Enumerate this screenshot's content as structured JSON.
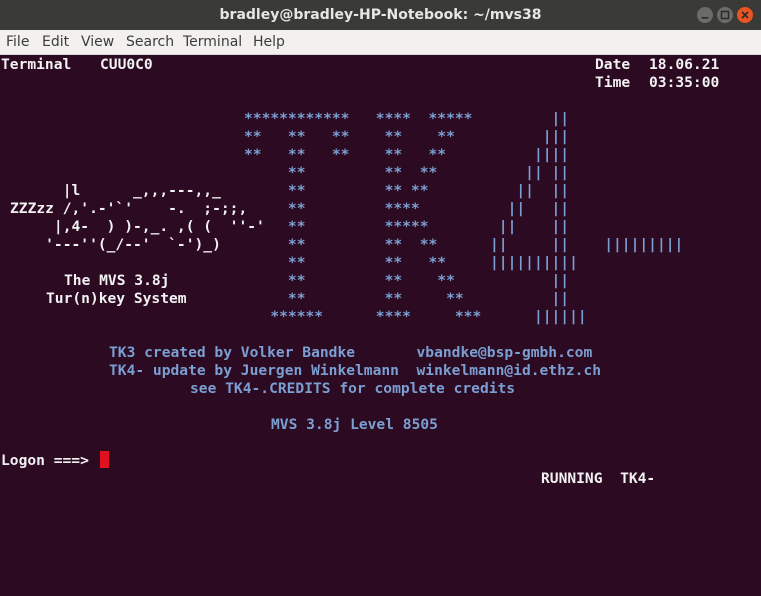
{
  "window": {
    "title": "bradley@bradley-HP-Notebook: ~/mvs38",
    "buttons": [
      "minimize-icon",
      "maximize-icon",
      "close-icon"
    ]
  },
  "menu": [
    "File",
    "Edit",
    "View",
    "Search",
    "Terminal",
    "Help"
  ],
  "colors": {
    "terminal_bg": "#2c0a22",
    "text_white": "#f2f2f2",
    "text_blue": "#7b9fd2",
    "cursor": "#e2111f",
    "close_button": "#e95420"
  },
  "terminal": {
    "terminal_label": "Terminal",
    "terminal_id": "CUU0C0",
    "date_label": "Date",
    "date_value": "18.06.21",
    "time_label": "Time",
    "time_value": "03:35:00",
    "tk4_art": [
      "************   ****  *****         ||",
      "**   **   **    **    **          |||",
      "**   **   **    **   **          ||||",
      "     **         **  **          || ||",
      "     **         ** **          ||  ||",
      "     **         ****          ||   ||",
      "     **         *****        ||    ||",
      "     **         **  **      ||     ||    |||||||||",
      "     **         **   **     ||||||||||",
      "     **         **    **           ||",
      "     **         **     **          ||",
      "   ******      ****     ***      ||||||"
    ],
    "turkey_art": [
      "      |l      _,,,---,,_",
      "ZZZzz /,'.-'`'    -.  ;-;;,",
      "     |,4-  ) )-,_. ,( (  ''-'",
      "    '---''(_/--'  `-')_)"
    ],
    "product_line1": "The MVS 3.8j",
    "product_line2": "Tur(n)key System",
    "credits": [
      "TK3 created by Volker Bandke       vbandke@bsp-gmbh.com",
      "TK4- update by Juergen Winkelmann  winkelmann@id.ethz.ch",
      "see TK4-.CREDITS for complete credits"
    ],
    "level": "MVS 3.8j Level 8505",
    "logon_prompt": "Logon ===>",
    "status": "RUNNING  TK4-"
  }
}
